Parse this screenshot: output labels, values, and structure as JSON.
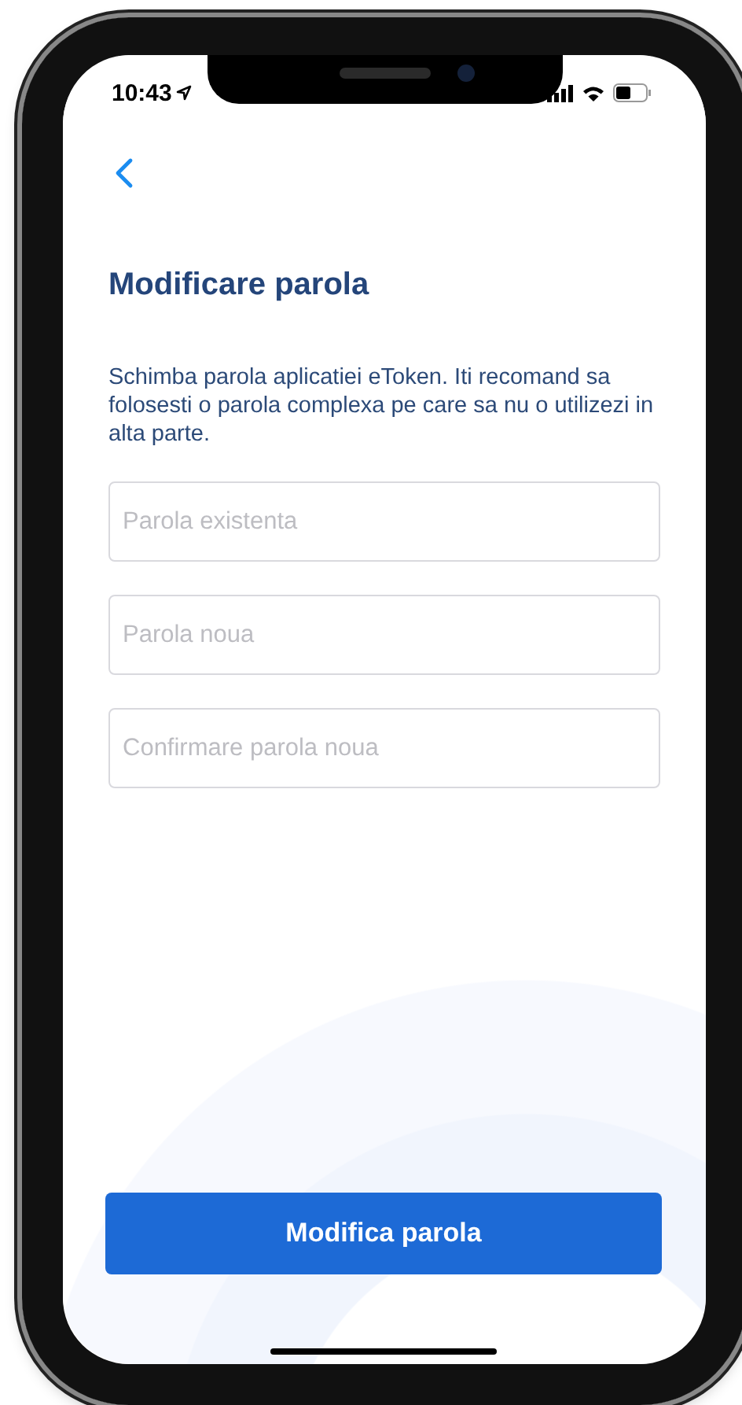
{
  "status_bar": {
    "time": "10:43"
  },
  "title": "Modificare parola",
  "description": "Schimba parola aplicatiei eToken. Iti recomand sa folosesti o parola complexa pe care sa nu o utilizezi in alta parte.",
  "fields": [
    {
      "placeholder": "Parola existenta"
    },
    {
      "placeholder": "Parola noua"
    },
    {
      "placeholder": "Confirmare parola noua"
    }
  ],
  "button": {
    "label": "Modifica parola"
  }
}
